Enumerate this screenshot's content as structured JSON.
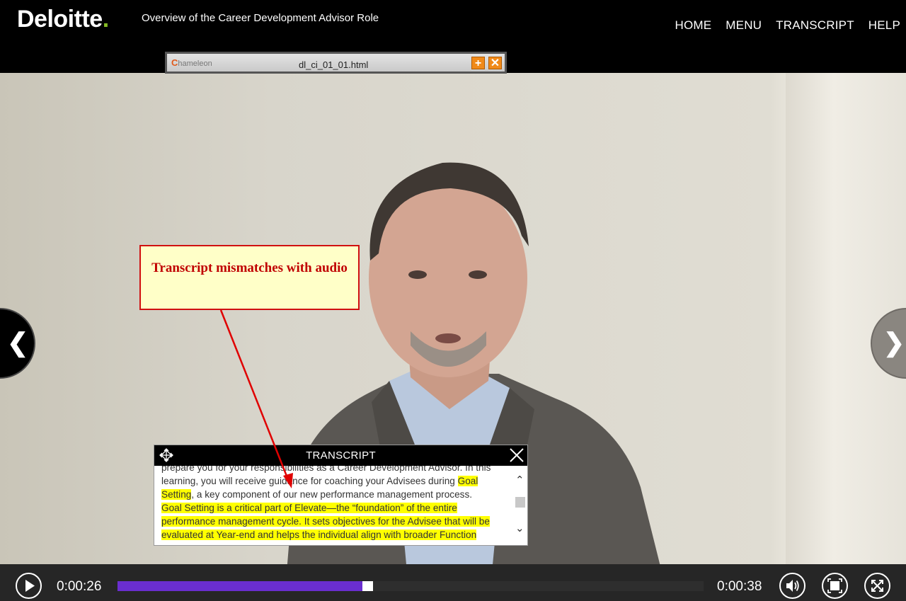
{
  "header": {
    "logo": "Deloitte",
    "logo_dot": ".",
    "course_title": "Overview of the Career Development Advisor Role",
    "nav": [
      "HOME",
      "MENU",
      "TRANSCRIPT",
      "HELP"
    ]
  },
  "chameleon": {
    "logo": "hameleon",
    "logo_c": "C",
    "filename": "dl_ci_01_01.html",
    "add_label": "+",
    "close_label": "✕"
  },
  "callout": {
    "text": "Transcript mismatches with audio"
  },
  "transcript": {
    "title": "TRANSCRIPT",
    "line1": "prepare you for your responsibilities as a Career Development Advisor. In this",
    "line2_a": "learning, you will receive guidance for coaching your Advisees during ",
    "line2_hl": "Goal Setting",
    "line2_b": ", a key component of our new performance management process.",
    "line3_hl": "Goal Setting is a critical part of Elevate—the “foundation” of the entire performance management cycle. It sets objectives for the Advisee that will be evaluated at Year-end and helps the individual align with broader Function"
  },
  "player": {
    "current_time": "0:00:26",
    "total_time": "0:00:38",
    "progress": 0.42
  },
  "colors": {
    "brand_green": "#86bc25",
    "progress_fill": "#6a2ecf",
    "highlight": "#ffff00",
    "callout_red": "#c00000"
  },
  "icons": [
    "prev-arrow-icon",
    "next-arrow-icon",
    "move-icon",
    "close-icon",
    "play-icon",
    "volume-icon",
    "fit-screen-icon",
    "fullscreen-icon"
  ]
}
